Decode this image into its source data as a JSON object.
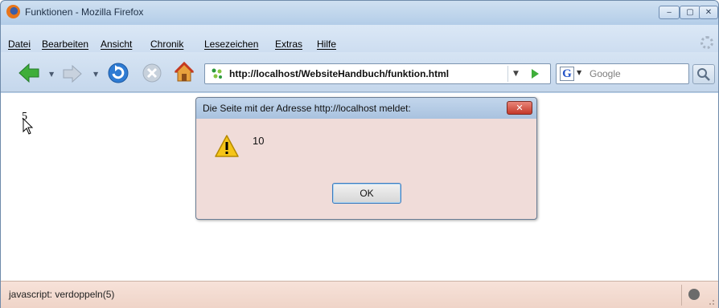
{
  "window": {
    "title": "Funktionen - Mozilla Firefox",
    "controls": {
      "minimize": "‒",
      "maximize": "▢",
      "close": "✕"
    }
  },
  "menu": [
    "Datei",
    "Bearbeiten",
    "Ansicht",
    "Chronik",
    "Lesezeichen",
    "Extras",
    "Hilfe"
  ],
  "navigation": {
    "url": "http://localhost/WebsiteHandbuch/funktion.html",
    "search_placeholder": "Google"
  },
  "page": {
    "text": "5"
  },
  "status": {
    "text": "javascript: verdoppeln(5)"
  },
  "dialog": {
    "title": "Die Seite mit der Adresse http://localhost meldet:",
    "message": "10",
    "ok_label": "OK",
    "close_label": "✕"
  },
  "colors": {
    "back_arrow": "#3fae3a",
    "reload": "#2e7bd3",
    "dialog_bg": "#f0dcd9",
    "statusbar_bg": "#f3dbd1",
    "dialog_close": "#c4392a"
  }
}
